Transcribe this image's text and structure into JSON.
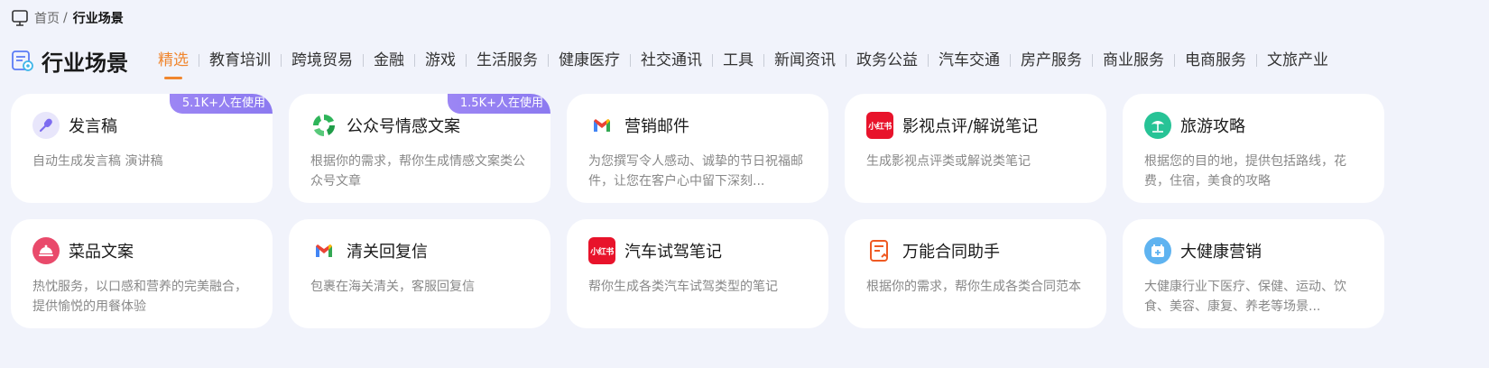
{
  "breadcrumb": {
    "home": "首页",
    "separator": "/",
    "current": "行业场景"
  },
  "page_title": "行业场景",
  "tabs": [
    {
      "label": "精选",
      "active": true
    },
    {
      "label": "教育培训"
    },
    {
      "label": "跨境贸易"
    },
    {
      "label": "金融"
    },
    {
      "label": "游戏"
    },
    {
      "label": "生活服务"
    },
    {
      "label": "健康医疗"
    },
    {
      "label": "社交通讯"
    },
    {
      "label": "工具"
    },
    {
      "label": "新闻资讯"
    },
    {
      "label": "政务公益"
    },
    {
      "label": "汽车交通"
    },
    {
      "label": "房产服务"
    },
    {
      "label": "商业服务"
    },
    {
      "label": "电商服务"
    },
    {
      "label": "文旅产业"
    }
  ],
  "colors": {
    "accent": "#f0862e",
    "badge": "#9c86f4",
    "background": "#f1f3fb"
  },
  "cards": [
    {
      "title": "发言稿",
      "desc": "自动生成发言稿 演讲稿",
      "badge": "5.1K+人在使用",
      "icon": "microphone-icon"
    },
    {
      "title": "公众号情感文案",
      "desc": "根据你的需求，帮你生成情感文案类公众号文章",
      "badge": "1.5K+人在使用",
      "icon": "wechat-channel-icon"
    },
    {
      "title": "营销邮件",
      "desc": "为您撰写令人感动、诚挚的节日祝福邮件，让您在客户心中留下深刻...",
      "icon": "gmail-icon"
    },
    {
      "title": "影视点评/解说笔记",
      "desc": "生成影视点评类或解说类笔记",
      "icon": "xiaohongshu-icon",
      "icon_text": "小红书"
    },
    {
      "title": "旅游攻略",
      "desc": "根据您的目的地，提供包括路线，花费，住宿，美食的攻略",
      "icon": "beach-icon"
    },
    {
      "title": "菜品文案",
      "desc": "热忱服务，以口感和营养的完美融合，提供愉悦的用餐体验",
      "icon": "dish-icon"
    },
    {
      "title": "清关回复信",
      "desc": "包裹在海关清关，客服回复信",
      "icon": "gmail-icon"
    },
    {
      "title": "汽车试驾笔记",
      "desc": "帮你生成各类汽车试驾类型的笔记",
      "icon": "xiaohongshu-icon",
      "icon_text": "小红书"
    },
    {
      "title": "万能合同助手",
      "desc": "根据你的需求，帮你生成各类合同范本",
      "icon": "contract-icon"
    },
    {
      "title": "大健康营销",
      "desc": "大健康行业下医疗、保健、运动、饮食、美容、康复、养老等场景...",
      "icon": "health-calendar-icon"
    }
  ]
}
